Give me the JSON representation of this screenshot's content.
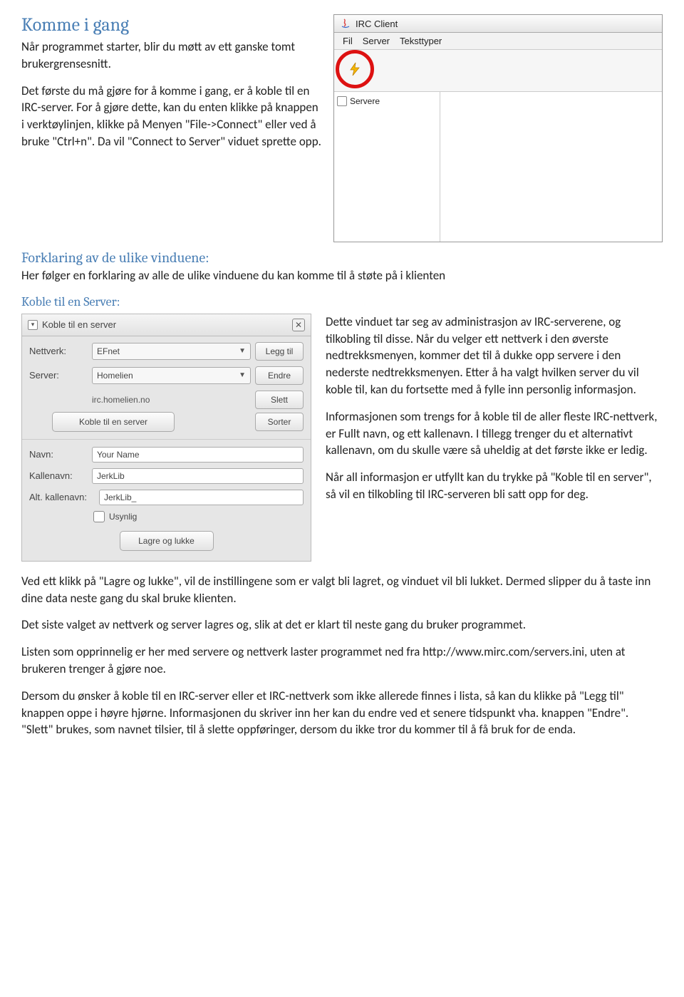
{
  "headings": {
    "h1": "Komme i gang",
    "h2": "Forklaring av de ulike vinduene:",
    "h3": "Koble til en Server:"
  },
  "intro": {
    "p1": "Når programmet starter, blir du møtt av ett ganske tomt brukergrensesnitt.",
    "p2": "Det første du må gjøre for å komme i gang, er å koble til en IRC-server. For å gjøre dette, kan du enten klikke på knappen i verktøylinjen, klikke på Menyen \"File->Connect\" eller ved å bruke \"Ctrl+n\". Da vil \"Connect to Server\" viduet sprette opp."
  },
  "forklaring_p": "Her følger en forklaring av alle de ulike vinduene du kan komme til å støte på i klienten",
  "client_window": {
    "title": "IRC Client",
    "menu": [
      "Fil",
      "Server",
      "Teksttyper"
    ],
    "tree_item": "Servere"
  },
  "dialog": {
    "title": "Koble til en server",
    "labels": {
      "nettverk": "Nettverk:",
      "server": "Server:",
      "navn": "Navn:",
      "kallenavn": "Kallenavn:",
      "alt_kallenavn": "Alt. kallenavn:"
    },
    "values": {
      "nettverk": "EFnet",
      "server": "Homelien",
      "server_url": "irc.homelien.no",
      "navn": "Your Name",
      "kallenavn": "JerkLib",
      "alt_kallenavn": "JerkLib_"
    },
    "buttons": {
      "legg_til": "Legg til",
      "endre": "Endre",
      "slett": "Slett",
      "sorter": "Sorter",
      "koble": "Koble til en server",
      "lagre": "Lagre og lukke"
    },
    "checkbox": "Usynlig"
  },
  "mid_text": {
    "p1": "Dette vinduet tar seg av administrasjon av IRC-serverene, og tilkobling til disse. Når du velger ett nettverk i den øverste nedtrekksmenyen, kommer det til å dukke opp servere i den nederste nedtrekksmenyen. Etter å ha valgt hvilken server du vil koble til, kan du fortsette med å fylle inn personlig informasjon.",
    "p2": "Informasjonen som trengs for å koble til de aller fleste IRC-nettverk, er Fullt navn, og ett kallenavn. I tillegg trenger du et alternativt kallenavn, om du skulle være så uheldig at det første ikke er ledig.",
    "p3": "Når all informasjon er utfyllt kan du trykke på \"Koble til en server\", så vil en tilkobling til IRC-serveren bli satt opp for deg."
  },
  "bottom": {
    "p1": "Ved ett klikk på \"Lagre og lukke\", vil de instillingene som er valgt bli lagret, og vinduet vil bli lukket. Dermed slipper du å taste inn dine data neste gang du skal bruke klienten.",
    "p2": "Det siste valget av nettverk og server lagres og, slik at det er klart til neste gang du bruker programmet.",
    "p3": "Listen som opprinnelig er her med servere og nettverk laster programmet ned fra http://www.mirc.com/servers.ini, uten at brukeren trenger å gjøre noe.",
    "p4": "Dersom du ønsker å koble til en IRC-server eller et IRC-nettverk som ikke allerede finnes i lista, så kan du klikke på \"Legg til\" knappen oppe i høyre hjørne. Informasjonen du skriver inn her kan du endre ved et senere tidspunkt vha. knappen \"Endre\". \"Slett\" brukes, som navnet tilsier, til å slette oppføringer, dersom du ikke tror du kommer til å få bruk for de enda."
  }
}
